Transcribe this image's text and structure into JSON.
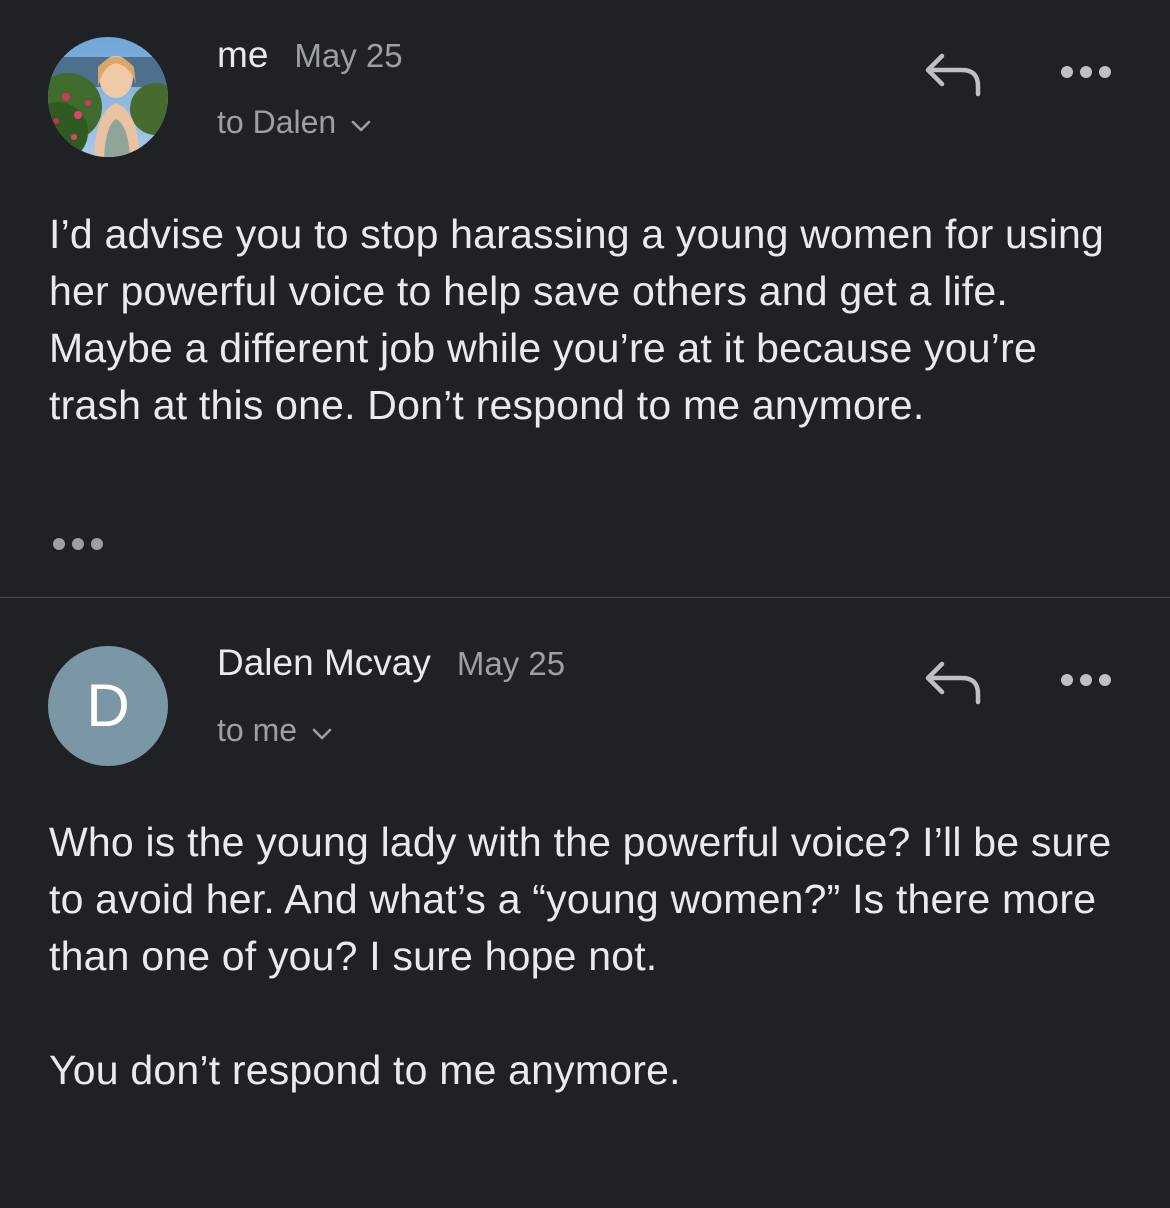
{
  "messages": [
    {
      "sender": "me",
      "date": "May 25",
      "recipient": "to Dalen",
      "avatar": "profile-photo",
      "body": "I’d advise you to stop harassing a young women for using her powerful voice to help save others and get a life. Maybe a different job while you’re at it because you’re trash at this one. Don’t respond to me anymore.",
      "has_trimmed_content": true
    },
    {
      "sender": "Dalen Mcvay",
      "date": "May 25",
      "recipient": "to me",
      "avatar_letter": "D",
      "avatar_color": "#7b96a4",
      "body": "Who is the young lady with the powerful voice? I’ll be sure to avoid her. And what’s a “young women?” Is there more than one of you? I sure hope not.\n\nYou don’t respond to me anymore."
    }
  ],
  "icons": {
    "reply": "reply-icon",
    "more": "more-options-icon",
    "chevron": "chevron-down-icon",
    "trimmed": "show-trimmed-content-icon"
  },
  "colors": {
    "background": "#202124",
    "text_primary": "#e8eaed",
    "text_secondary": "#9aa0a6",
    "divider": "#4a4c50"
  }
}
